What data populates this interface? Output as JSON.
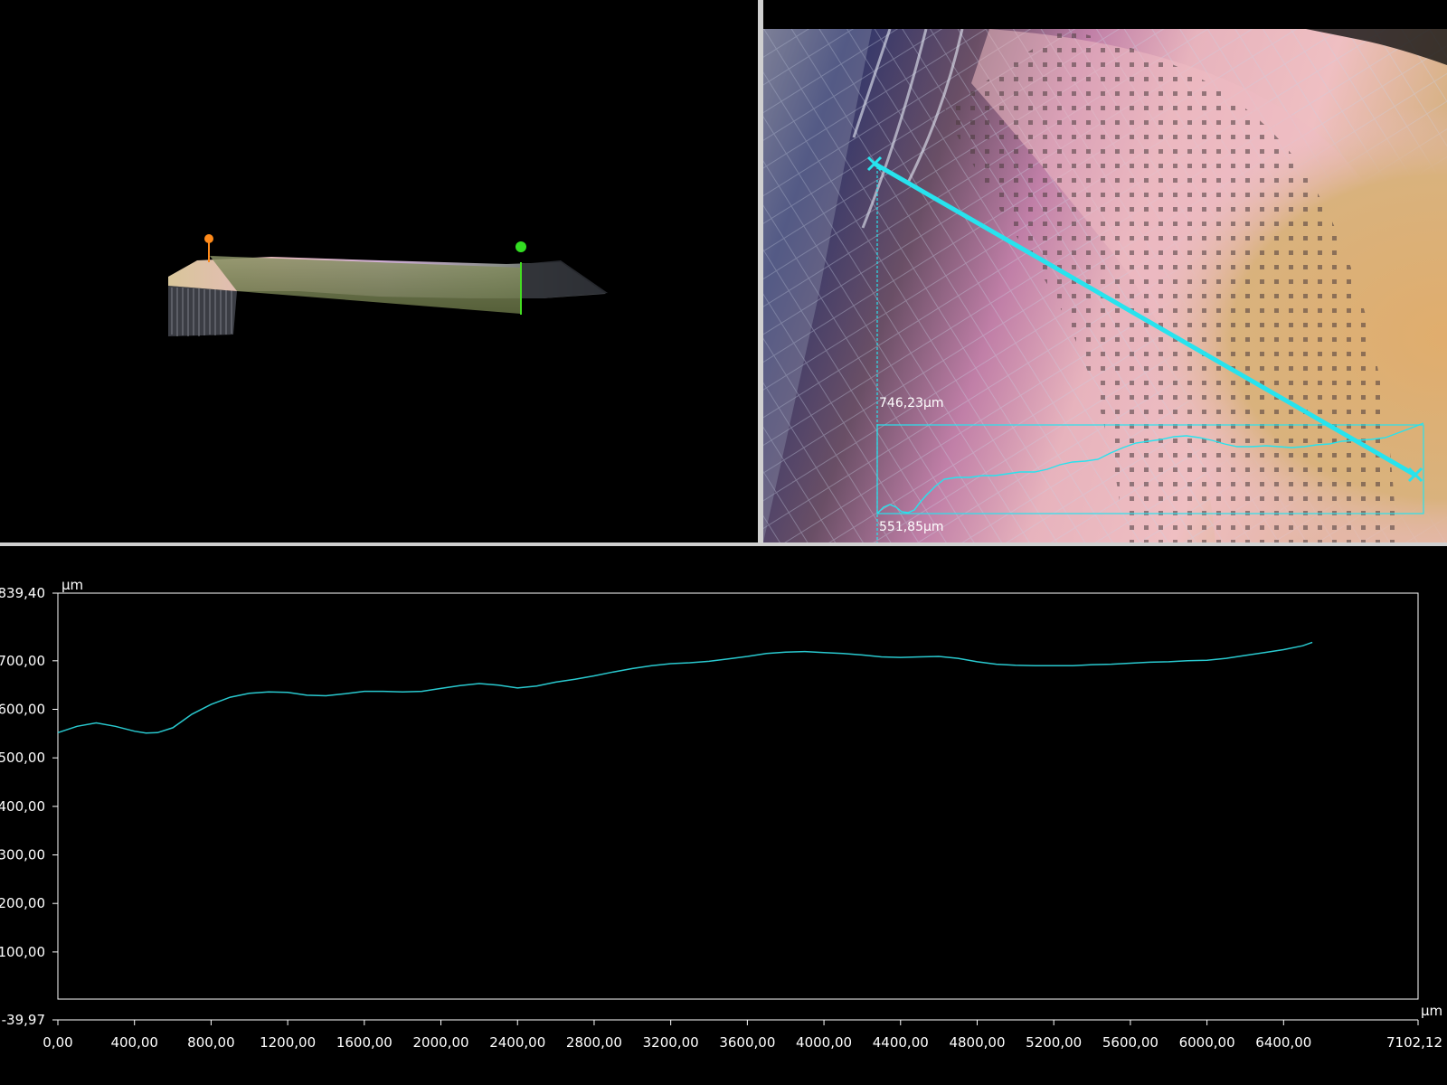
{
  "views": {
    "view3d": {
      "markers": [
        {
          "name": "start-marker",
          "color": "#ff8a1a"
        },
        {
          "name": "end-marker",
          "color": "#33dd22"
        }
      ]
    },
    "view2d": {
      "line_color": "#27e3ee",
      "labels": {
        "max_height": "746,23µm",
        "min_height": "551,85µm"
      }
    }
  },
  "chart_data": {
    "type": "line",
    "title": "",
    "xlabel": "µm",
    "ylabel": "µm",
    "xlim": [
      0,
      7102.12
    ],
    "ylim": [
      -39.97,
      839.4
    ],
    "xticks": [
      "0,00",
      "400,00",
      "800,00",
      "1200,00",
      "1600,00",
      "2000,00",
      "2400,00",
      "2800,00",
      "3200,00",
      "3600,00",
      "4000,00",
      "4400,00",
      "4800,00",
      "5200,00",
      "5600,00",
      "6000,00",
      "6400,00",
      "7102,12"
    ],
    "yticks": [
      "839,40",
      "700,00",
      "600,00",
      "500,00",
      "400,00",
      "300,00",
      "200,00",
      "100,00",
      "-39,97"
    ],
    "line_color": "#29c9cf",
    "series": [
      {
        "x": [
          0,
          100,
          200,
          300,
          400,
          460,
          520,
          600,
          700,
          800,
          900,
          1000,
          1100,
          1200,
          1300,
          1400,
          1500,
          1600,
          1700,
          1800,
          1900,
          2000,
          2100,
          2200,
          2300,
          2400,
          2500,
          2600,
          2700,
          2800,
          2900,
          3000,
          3100,
          3200,
          3300,
          3400,
          3500,
          3600,
          3700,
          3800,
          3900,
          4000,
          4100,
          4200,
          4300,
          4400,
          4500,
          4600,
          4700,
          4800,
          4900,
          5000,
          5100,
          5200,
          5300,
          5400,
          5500,
          5600,
          5700,
          5800,
          5900,
          6000,
          6100,
          6200,
          6300,
          6400,
          6500,
          6550
        ],
        "y": [
          552,
          565,
          572,
          565,
          555,
          551,
          552,
          562,
          590,
          610,
          625,
          633,
          636,
          635,
          629,
          628,
          632,
          637,
          637,
          636,
          637,
          643,
          649,
          653,
          650,
          644,
          648,
          656,
          662,
          669,
          677,
          684,
          690,
          694,
          696,
          699,
          704,
          709,
          715,
          718,
          719,
          717,
          715,
          712,
          708,
          707,
          708,
          709,
          705,
          698,
          693,
          691,
          690,
          690,
          690,
          692,
          693,
          695,
          697,
          698,
          700,
          701,
          705,
          711,
          717,
          723,
          731,
          738
        ]
      }
    ]
  }
}
